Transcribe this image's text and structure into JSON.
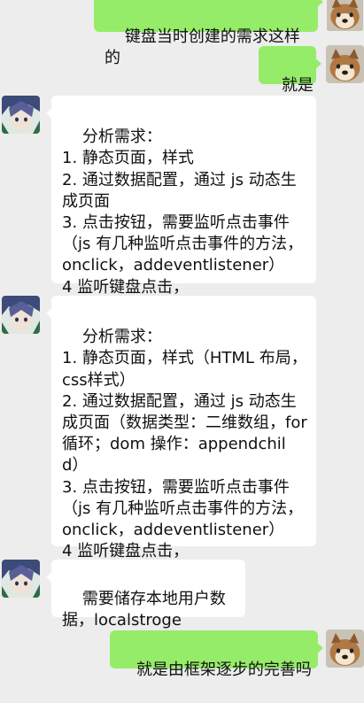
{
  "messages": [
    {
      "side": "right",
      "text": "键盘当时创建的需求这样的"
    },
    {
      "side": "right",
      "text": "就是"
    },
    {
      "side": "left",
      "text": "分析需求：\n1. 静态页面，样式\n2. 通过数据配置，通过 js 动态生成页面\n3. 点击按钮，需要监听点击事件（js 有几种监听点击事件的方法，onclick，addeventlistener）\n4 监听键盘点击，"
    },
    {
      "side": "left",
      "text": "分析需求：\n1. 静态页面，样式（HTML 布局，css样式）\n2. 通过数据配置，通过 js 动态生成页面（数据类型：二维数组，for 循环；dom 操作：appendchild）\n3. 点击按钮，需要监听点击事件（js 有几种监听点击事件的方法，onclick，addeventlistener）\n4 监听键盘点击，"
    },
    {
      "side": "left",
      "text": "需要储存本地用户数据，localstroge"
    },
    {
      "side": "right",
      "text": "就是由框架逐步的完善吗"
    }
  ],
  "avatars": {
    "self": "dog-avatar-icon",
    "other": "anime-character-avatar-icon"
  },
  "colors": {
    "background": "#ededed",
    "outgoing_bubble": "#95ec69",
    "incoming_bubble": "#ffffff"
  }
}
